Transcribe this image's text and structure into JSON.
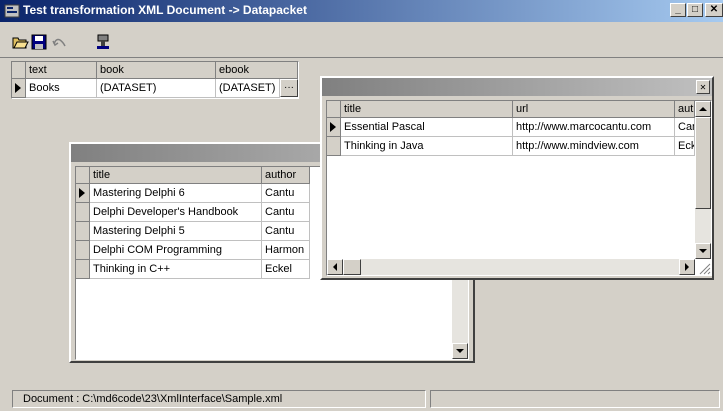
{
  "window": {
    "title": "Test transformation XML Document -> Datapacket",
    "min_label": "_",
    "max_label": "□",
    "close_label": "✕"
  },
  "toolbar": {
    "buttons": [
      "open-icon",
      "save-icon",
      "undo-icon",
      "run-icon"
    ]
  },
  "main_grid": {
    "columns": [
      "text",
      "book",
      "ebook"
    ],
    "rows": [
      {
        "text": "Books",
        "book": "(DATASET)",
        "ebook": "(DATASET)"
      }
    ],
    "ellipsis": "···"
  },
  "books_window": {
    "columns": [
      "title",
      "author"
    ],
    "rows": [
      {
        "title": "Mastering Delphi 6",
        "author": "Cantu"
      },
      {
        "title": "Delphi Developer's Handbook",
        "author": "Cantu"
      },
      {
        "title": "Mastering Delphi 5",
        "author": "Cantu"
      },
      {
        "title": "Delphi COM Programming",
        "author": "Harmon"
      },
      {
        "title": "Thinking in C++",
        "author": "Eckel"
      }
    ]
  },
  "ebooks_window": {
    "close_label": "✕",
    "columns": [
      "title",
      "url",
      "autl"
    ],
    "rows": [
      {
        "title": "Essential Pascal",
        "url": "http://www.marcocantu.com",
        "author": "Can"
      },
      {
        "title": "Thinking in Java",
        "url": "http://www.mindview.com",
        "author": "Eck"
      }
    ]
  },
  "statusbar": {
    "document": "Document : C:\\md6code\\23\\XmlInterface\\Sample.xml"
  },
  "colors": {
    "title_active": "#0a246a",
    "title_gradient_end": "#a6caf0",
    "face": "#d4d0c8"
  }
}
